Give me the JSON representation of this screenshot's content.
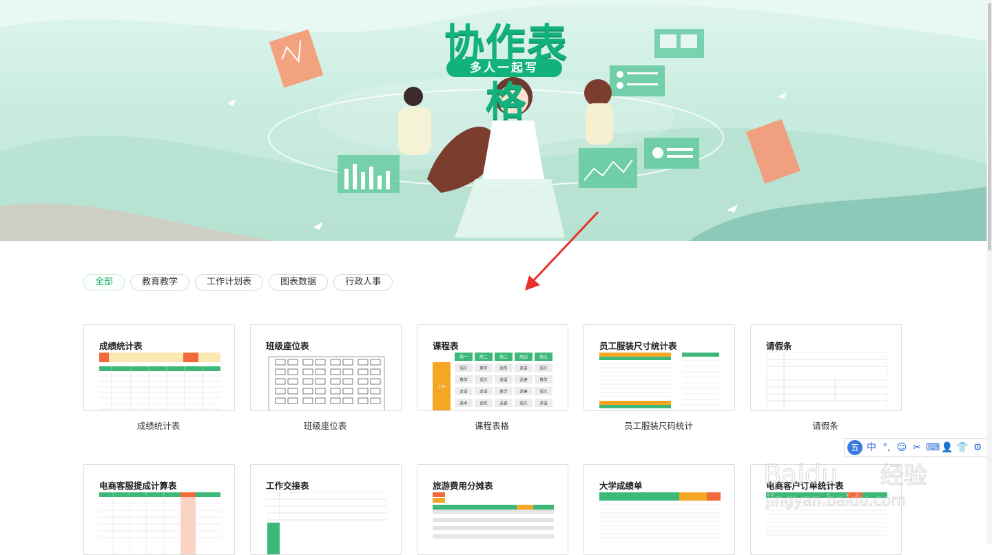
{
  "banner": {
    "title": "协作表格",
    "subtitle": "多人一起写"
  },
  "filters": [
    {
      "label": "全部",
      "active": true
    },
    {
      "label": "教育教学",
      "active": false
    },
    {
      "label": "工作计划表",
      "active": false
    },
    {
      "label": "图表数据",
      "active": false
    },
    {
      "label": "行政人事",
      "active": false
    }
  ],
  "templates_row1": [
    {
      "title": "成绩统计表",
      "caption": "成绩统计表"
    },
    {
      "title": "班级座位表",
      "caption": "班级座位表"
    },
    {
      "title": "课程表",
      "caption": "课程表格"
    },
    {
      "title": "员工服装尺寸统计表",
      "caption": "员工服装尺码统计"
    },
    {
      "title": "请假条",
      "caption": "请假条"
    }
  ],
  "templates_row2": [
    {
      "title": "电商客服提成计算表"
    },
    {
      "title": "工作交接表"
    },
    {
      "title": "旅游费用分摊表"
    },
    {
      "title": "大学成绩单"
    },
    {
      "title": "电商客户订单统计表"
    }
  ],
  "schedule": {
    "days": [
      "周一",
      "周二",
      "周三",
      "周四",
      "周五"
    ],
    "period": "上午",
    "rows": [
      [
        "语文",
        "数学",
        "自然",
        "英语",
        "语文"
      ],
      [
        "数学",
        "语文",
        "英语",
        "品德",
        "数学"
      ],
      [
        "英语",
        "英语",
        "数学",
        "品德",
        "语文"
      ],
      [
        "美术",
        "自然",
        "品德",
        "语文",
        "英语"
      ]
    ]
  },
  "ime": {
    "logo": "五",
    "items": [
      "中",
      "°,",
      "☺",
      "✂",
      "⌨",
      "👤",
      "👕",
      "⚙"
    ]
  },
  "watermark": {
    "text1": "Baidu",
    "text2": "经验",
    "text3": "jingyan.baidu.com"
  },
  "colors": {
    "accent": "#13b27c",
    "arrow": "#e8302a",
    "orange": "#f5a623",
    "red": "#f05a28"
  }
}
